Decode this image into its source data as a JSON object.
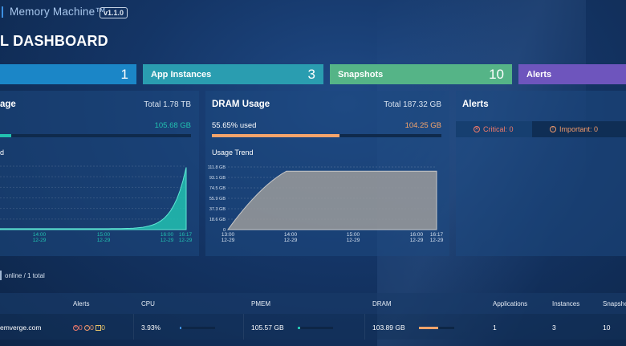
{
  "header": {
    "brand": "Memory Machine™",
    "version": "v1.1.0"
  },
  "page": {
    "title": "L DASHBOARD"
  },
  "stats": [
    {
      "label": "",
      "value": "1"
    },
    {
      "label": "App Instances",
      "value": "3"
    },
    {
      "label": "Snapshots",
      "value": "10"
    },
    {
      "label": "Alerts",
      "value": ""
    }
  ],
  "pmem": {
    "title": "age",
    "total": "Total 1.78 TB",
    "used_value": "105.68 GB",
    "used_fraction": 0.058,
    "trend_label": "d",
    "accent": "#22c1b0"
  },
  "dram": {
    "title": "DRAM Usage",
    "total": "Total 187.32 GB",
    "used_label": "55.65% used",
    "used_value": "104.25 GB",
    "used_fraction": 0.5565,
    "trend_label": "Usage Trend",
    "accent": "#f5a46b"
  },
  "alerts_card": {
    "title": "Alerts",
    "critical": "Critical: 0",
    "important": "Important: 0"
  },
  "summary": {
    "online": "online / 1 total"
  },
  "table": {
    "headers": {
      "alerts": "Alerts",
      "cpu": "CPU",
      "pmem": "PMEM",
      "dram": "DRAM",
      "applications": "Applications",
      "instances": "Instances",
      "snapshots": "Snapsho"
    },
    "row": {
      "host": "emverge.com",
      "alert_critical": "0",
      "alert_important": "0",
      "alert_warning": "0",
      "cpu": "3.93%",
      "cpu_fraction": 0.04,
      "pmem": "105.57 GB",
      "pmem_fraction": 0.06,
      "dram": "103.89 GB",
      "dram_fraction": 0.55,
      "applications": "1",
      "instances": "3",
      "snapshots": "10"
    }
  },
  "chart_data": [
    {
      "type": "area",
      "title": "",
      "x": [
        "13:00 12-29",
        "14:00 12-29",
        "15:00 12-29",
        "16:00 12-29",
        "16:17 12-29"
      ],
      "x_ticks": [
        [
          "14:00",
          "12-29"
        ],
        [
          "15:00",
          "12-29"
        ],
        [
          "16:00",
          "12-29"
        ],
        [
          "16:17",
          "12-29"
        ]
      ],
      "series": [
        {
          "values": [
            2,
            4,
            10,
            28,
            105.68
          ]
        }
      ],
      "color": "#22c1b0",
      "grid": true
    },
    {
      "type": "area",
      "title": "",
      "y_ticks": [
        "0",
        "18.6 GB",
        "37.3 GB",
        "55.9 GB",
        "74.5 GB",
        "93.1 GB",
        "111.8 GB"
      ],
      "ylim": [
        0,
        111.8
      ],
      "x_ticks": [
        [
          "13:00",
          "12-29"
        ],
        [
          "14:00",
          "12-29"
        ],
        [
          "15:00",
          "12-29"
        ],
        [
          "16:00",
          "12-29"
        ],
        [
          "16:17",
          "12-29"
        ]
      ],
      "points": [
        [
          0,
          0
        ],
        [
          0.28,
          104.25
        ],
        [
          1,
          104.25
        ]
      ],
      "color": "#9b9b9b",
      "grid": true
    }
  ]
}
